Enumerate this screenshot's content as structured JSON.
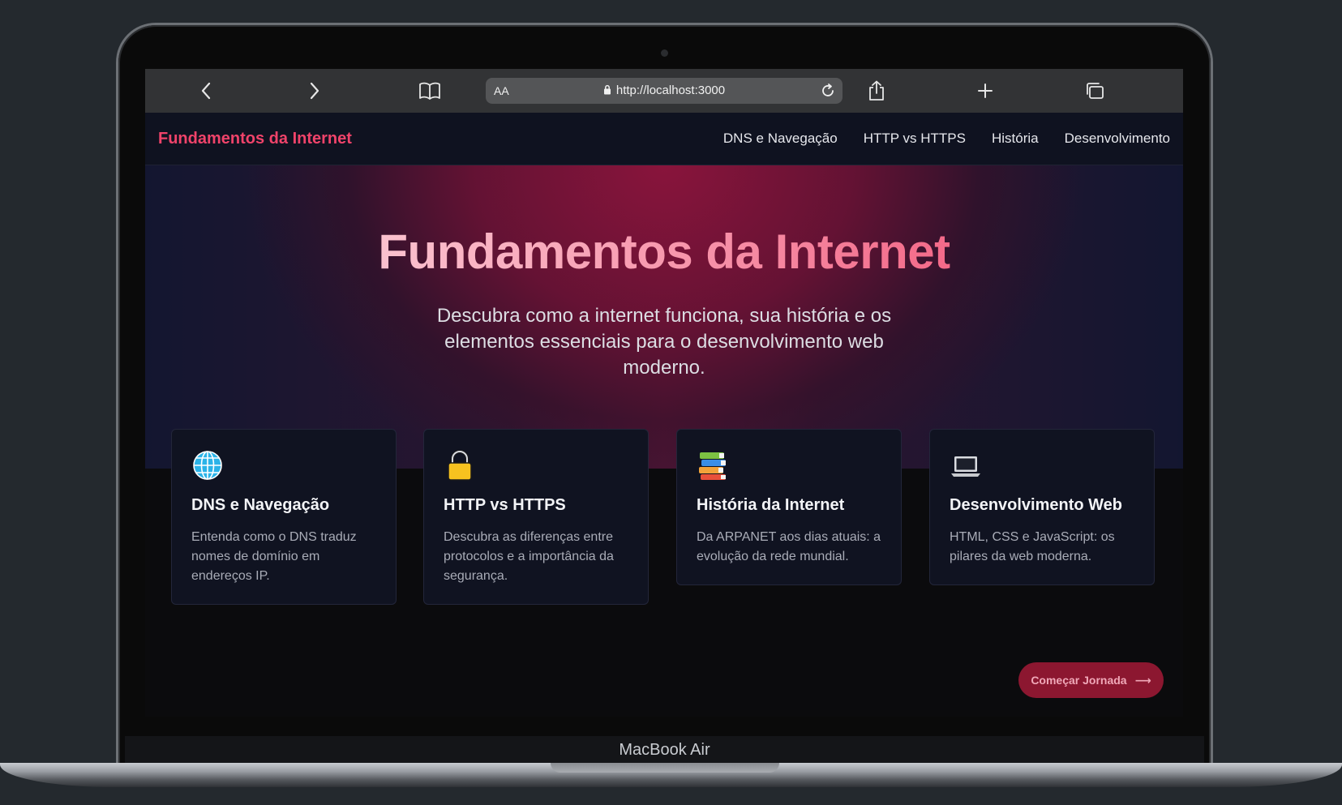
{
  "browser": {
    "url": "http://localhost:3000",
    "reader_label": "AA"
  },
  "site": {
    "brand": "Fundamentos da Internet",
    "nav": [
      {
        "label": "DNS e Navegação"
      },
      {
        "label": "HTTP vs HTTPS"
      },
      {
        "label": "História"
      },
      {
        "label": "Desenvolvimento"
      }
    ]
  },
  "hero": {
    "title": "Fundamentos da Internet",
    "subtitle": "Descubra como a internet funciona, sua história e os elementos essenciais para o desenvolvimento web moderno."
  },
  "cards": [
    {
      "icon": "globe-icon",
      "title": "DNS e Navegação",
      "description": "Entenda como o DNS traduz nomes de domínio em endereços IP."
    },
    {
      "icon": "lock-icon",
      "title": "HTTP vs HTTPS",
      "description": "Descubra as diferenças entre protocolos e a importância da segurança."
    },
    {
      "icon": "books-icon",
      "title": "História da Internet",
      "description": "Da ARPANET aos dias atuais: a evolução da rede mundial."
    },
    {
      "icon": "laptop-icon",
      "title": "Desenvolvimento Web",
      "description": "HTML, CSS e JavaScript: os pilares da web moderna."
    }
  ],
  "cta": {
    "label": "Começar Jornada",
    "arrow": "⟶"
  },
  "device": {
    "label": "MacBook Air"
  },
  "colors": {
    "accent": "#f0436a",
    "cta_bg": "#8c1730",
    "page_bg": "#0b0b0d",
    "card_bg": "#101321"
  }
}
